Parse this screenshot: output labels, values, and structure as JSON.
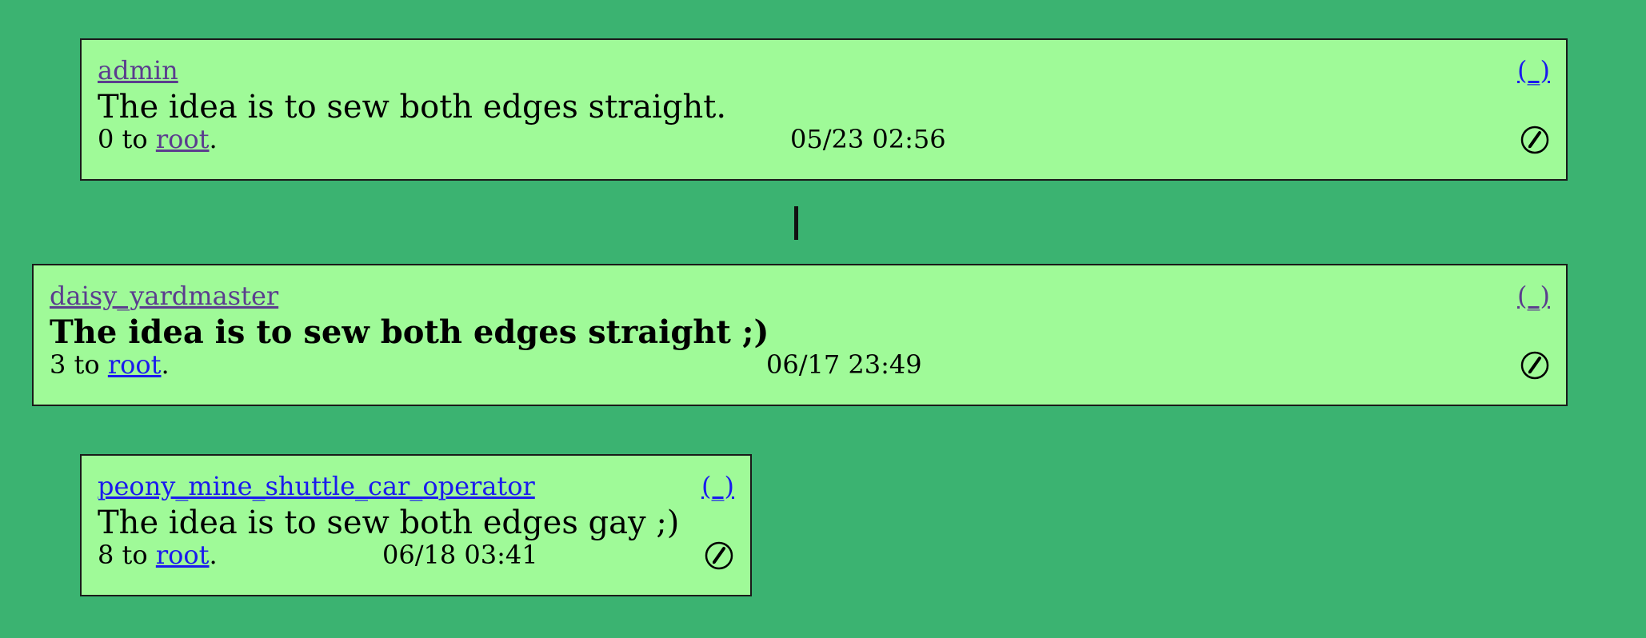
{
  "posts": [
    {
      "username": "admin",
      "collapse_label": "(_)",
      "message": "The idea is to sew both edges straight.",
      "score": "0",
      "to_word": "to",
      "target": "root",
      "period": ".",
      "timestamp": "05/23 02:56",
      "edit_icon": "edit-icon"
    },
    {
      "username": "daisy_yardmaster",
      "collapse_label": "(_)",
      "message": "The idea is to sew both edges straight ;)",
      "score": "3",
      "to_word": "to",
      "target": "root",
      "period": ".",
      "timestamp": "06/17 23:49",
      "edit_icon": "edit-icon"
    },
    {
      "username": "peony_mine_shuttle_car_operator",
      "collapse_label": "(_)",
      "message": "The idea is to sew both edges gay ;)",
      "score": "8",
      "to_word": "to",
      "target": "root",
      "period": ".",
      "timestamp": "06/18 03:41",
      "edit_icon": "edit-icon"
    }
  ],
  "colors": {
    "background": "#3bb371",
    "card": "#9ffa98",
    "visited_link": "#5b3d8e",
    "unvisited_link": "#1a1aee"
  }
}
